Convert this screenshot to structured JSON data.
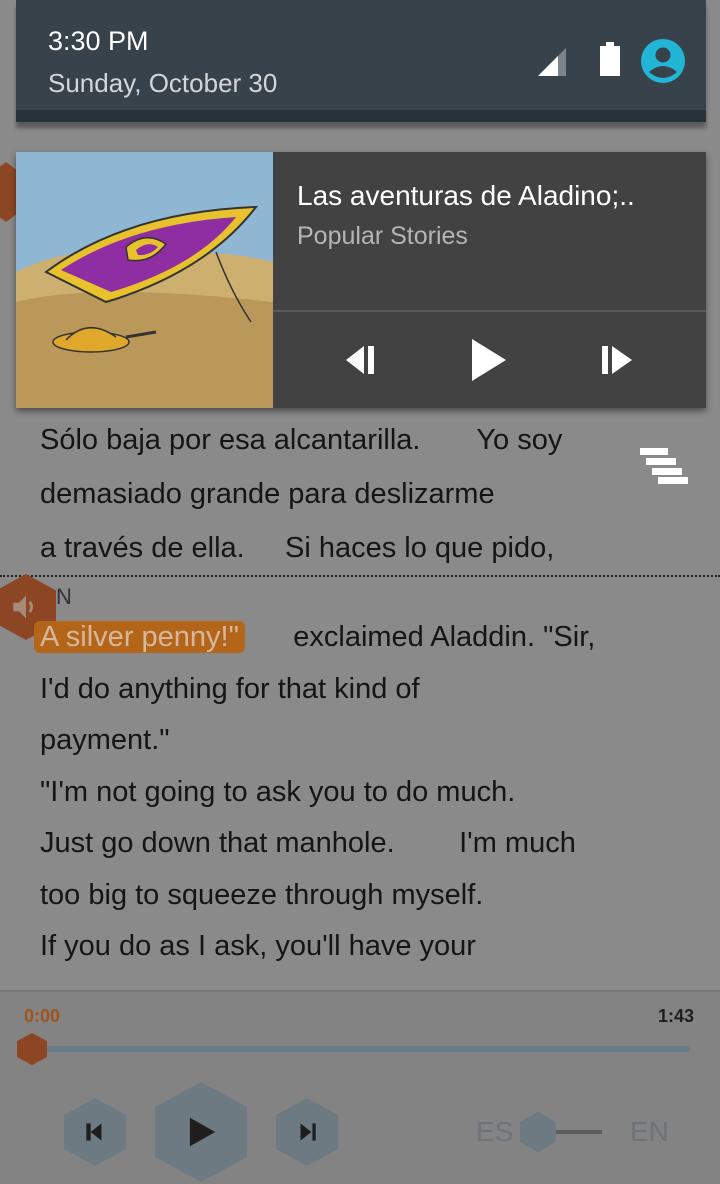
{
  "status": {
    "time": "3:30 PM",
    "date": "Sunday, October 30"
  },
  "media": {
    "title": "Las aventuras de Aladino;..",
    "subtitle": "Popular Stories"
  },
  "reader": {
    "es_lines": [
      "Sólo baja por esa alcantarilla.       Yo soy",
      "demasiado grande para deslizarme",
      "a través de ella.     Si haces lo que pido,"
    ],
    "lang_tag": "N",
    "highlight": "A silver penny!\"",
    "en_line1_rest": "exclaimed Aladdin. \"Sir,",
    "en_lines": [
      "I'd do anything for that kind of",
      "payment.\"",
      "\"I'm not going to ask you to do much.",
      "Just go down that manhole.        I'm much",
      "too big to squeeze through myself.",
      "If you do as I ask, you'll have your"
    ]
  },
  "player": {
    "time_start": "0:00",
    "time_end": "1:43",
    "progress": 0.0,
    "lang_left": "ES",
    "lang_right": "EN"
  },
  "colors": {
    "accent": "#8d4623",
    "shade": "#37424a",
    "card": "#424242",
    "profile": "#21b6d6"
  }
}
